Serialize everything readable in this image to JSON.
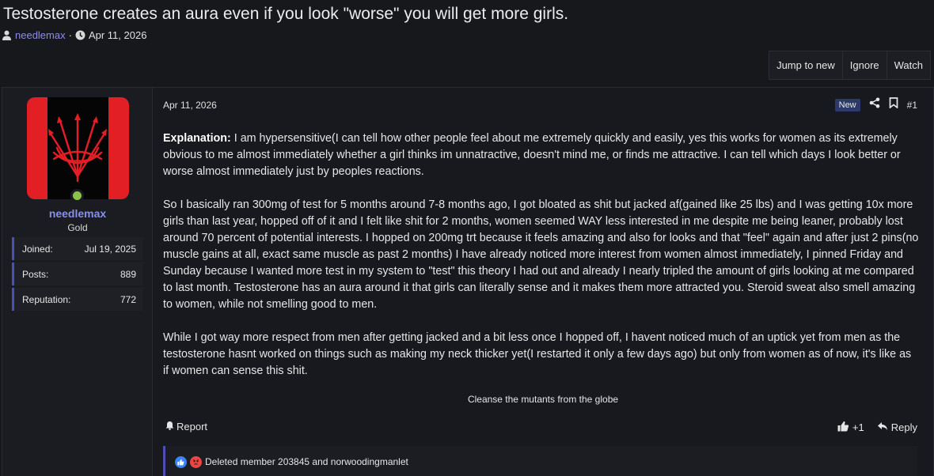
{
  "thread": {
    "title": "Testosterone creates an aura even if you look \"worse\" you will get more girls.",
    "author": "needlemax",
    "separator": "·",
    "date": "Apr 11, 2026"
  },
  "thread_buttons": {
    "jump": "Jump to new",
    "ignore": "Ignore",
    "watch": "Watch"
  },
  "user": {
    "name": "needlemax",
    "title": "Gold",
    "stats": [
      {
        "label": "Joined:",
        "value": "Jul 19, 2025"
      },
      {
        "label": "Posts:",
        "value": "889"
      },
      {
        "label": "Reputation:",
        "value": "772"
      }
    ],
    "avatar_colors": {
      "red": "#e31f26",
      "black": "#050505"
    },
    "online_color": "#8bc34a"
  },
  "post": {
    "date": "Apr 11, 2026",
    "new_badge": "New",
    "number": "#1",
    "explanation_label": "Explanation:",
    "paragraph1": " I am hypersensitive(I can tell how other people feel about me extremely quickly and easily, yes this works for women as its extremely obvious to me almost immediately whether a girl thinks im unnatractive, doesn't mind me, or finds me attractive. I can tell which days I look better or worse almost immediately just by peoples reactions.",
    "paragraph2": "So I basically ran 300mg of test for 5 months around 7-8 months ago, I got bloated as shit but jacked af(gained like 25 lbs) and I was getting 10x more girls than last year, hopped off of it and I felt like shit for 2 months, women seemed WAY less interested in me despite me being leaner, probably lost around 70 percent of potential interests. I hopped on 200mg trt because it feels amazing and also for looks and that \"feel\" again and after just 2 pins(no muscle gains at all, exact same muscle as past 2 months) I have already noticed more interest from women almost immediately, I pinned Friday and Sunday because I wanted more test in my system to \"test\" this theory I had out and already I nearly tripled the amount of girls looking at me compared to last month. Testosterone has an aura around it that girls can literally sense and it makes them more attracted you. Steroid sweat also smell amazing to women, while not smelling good to men.",
    "paragraph3": "While I got way more respect from men after getting jacked and a bit less once I hopped off, I havent noticed much of an uptick yet from men as the testosterone hasnt worked on things such as making my neck thicker yet(I restarted it only a few days ago) but only from women as of now, it's like as if women can sense this shit.",
    "signature": "Cleanse the mutants from the globe",
    "report_label": "Report",
    "like_count": "+1",
    "reply_label": "Reply",
    "reactions_text": "Deleted member 203845 and norwoodingmanlet"
  },
  "colors": {
    "accent": "#4c4fb3",
    "link": "#8a8fe6",
    "background": "#17181c"
  },
  "icons": [
    "user-icon",
    "clock-icon",
    "share-icon",
    "bookmark-icon",
    "bell-icon",
    "thumbs-up-icon",
    "reply-icon",
    "like-reaction-icon",
    "angry-reaction-icon"
  ]
}
